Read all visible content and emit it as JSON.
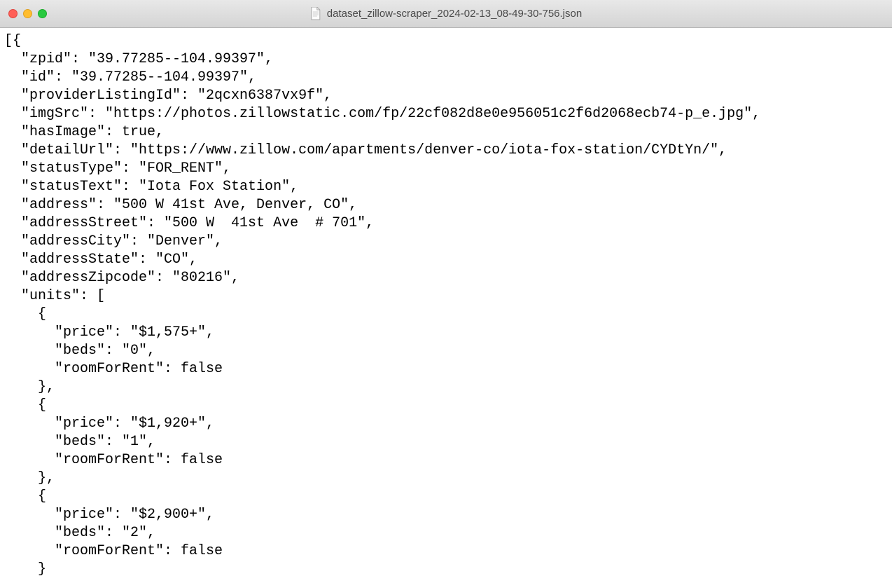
{
  "window": {
    "title": "dataset_zillow-scraper_2024-02-13_08-49-30-756.json"
  },
  "code": {
    "line01": "[{",
    "line02": "  \"zpid\": \"39.77285--104.99397\",",
    "line03": "  \"id\": \"39.77285--104.99397\",",
    "line04": "  \"providerListingId\": \"2qcxn6387vx9f\",",
    "line05": "  \"imgSrc\": \"https://photos.zillowstatic.com/fp/22cf082d8e0e956051c2f6d2068ecb74-p_e.jpg\",",
    "line06": "  \"hasImage\": true,",
    "line07": "  \"detailUrl\": \"https://www.zillow.com/apartments/denver-co/iota-fox-station/CYDtYn/\",",
    "line08": "  \"statusType\": \"FOR_RENT\",",
    "line09": "  \"statusText\": \"Iota Fox Station\",",
    "line10": "  \"address\": \"500 W 41st Ave, Denver, CO\",",
    "line11": "  \"addressStreet\": \"500 W  41st Ave  # 701\",",
    "line12": "  \"addressCity\": \"Denver\",",
    "line13": "  \"addressState\": \"CO\",",
    "line14": "  \"addressZipcode\": \"80216\",",
    "line15": "  \"units\": [",
    "line16": "    {",
    "line17": "      \"price\": \"$1,575+\",",
    "line18": "      \"beds\": \"0\",",
    "line19": "      \"roomForRent\": false",
    "line20": "    },",
    "line21": "    {",
    "line22": "      \"price\": \"$1,920+\",",
    "line23": "      \"beds\": \"1\",",
    "line24": "      \"roomForRent\": false",
    "line25": "    },",
    "line26": "    {",
    "line27": "      \"price\": \"$2,900+\",",
    "line28": "      \"beds\": \"2\",",
    "line29": "      \"roomForRent\": false",
    "line30": "    }"
  }
}
